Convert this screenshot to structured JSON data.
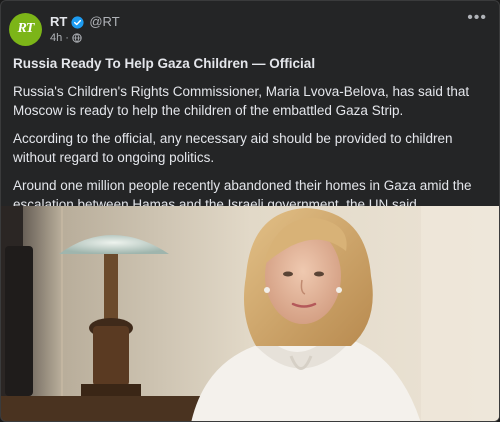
{
  "post": {
    "author": {
      "name": "RT",
      "handle": "@RT",
      "avatar_text": "RT",
      "verified": true,
      "avatar_color": "#7cb518"
    },
    "time": "4h",
    "title": "Russia Ready To Help Gaza Children — Official",
    "paragraphs": [
      "Russia's Children's Rights Commissioner, Maria Lvova-Belova, has said that Moscow is ready to help the children of the embattled Gaza Strip.",
      "According to the official, any necessary aid should be provided to children without regard to ongoing politics.",
      "Around one million people recently abandoned their homes in Gaza amid the escalation between Hamas and the Israeli government, the UN said."
    ],
    "more_label": "•••",
    "icons": {
      "verified": "verified-badge-icon",
      "audience": "globe-icon",
      "more": "more-options-icon"
    }
  }
}
